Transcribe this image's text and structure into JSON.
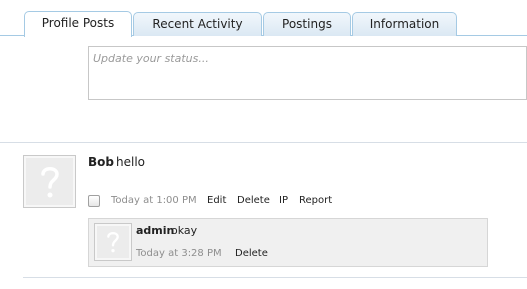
{
  "tabs": [
    {
      "label": "Profile Posts",
      "active": true
    },
    {
      "label": "Recent Activity",
      "active": false
    },
    {
      "label": "Postings",
      "active": false
    },
    {
      "label": "Information",
      "active": false
    }
  ],
  "status": {
    "placeholder": "Update your status..."
  },
  "post": {
    "author": "Bob",
    "message": "hello",
    "avatar_icon": "question-mark-avatar-icon",
    "timestamp": "Today at 1:00 PM",
    "actions": {
      "edit": "Edit",
      "delete": "Delete",
      "ip": "IP",
      "report": "Report"
    }
  },
  "comment": {
    "author": "admin",
    "message": "okay",
    "avatar_icon": "question-mark-avatar-icon",
    "timestamp": "Today at 3:28 PM",
    "actions": {
      "delete": "Delete"
    }
  },
  "colors": {
    "tab_border": "#a5cae4",
    "tab_bg": "#dbe8f3",
    "comment_bg": "#f0f0f0",
    "meta_text": "#8e8e8e"
  }
}
